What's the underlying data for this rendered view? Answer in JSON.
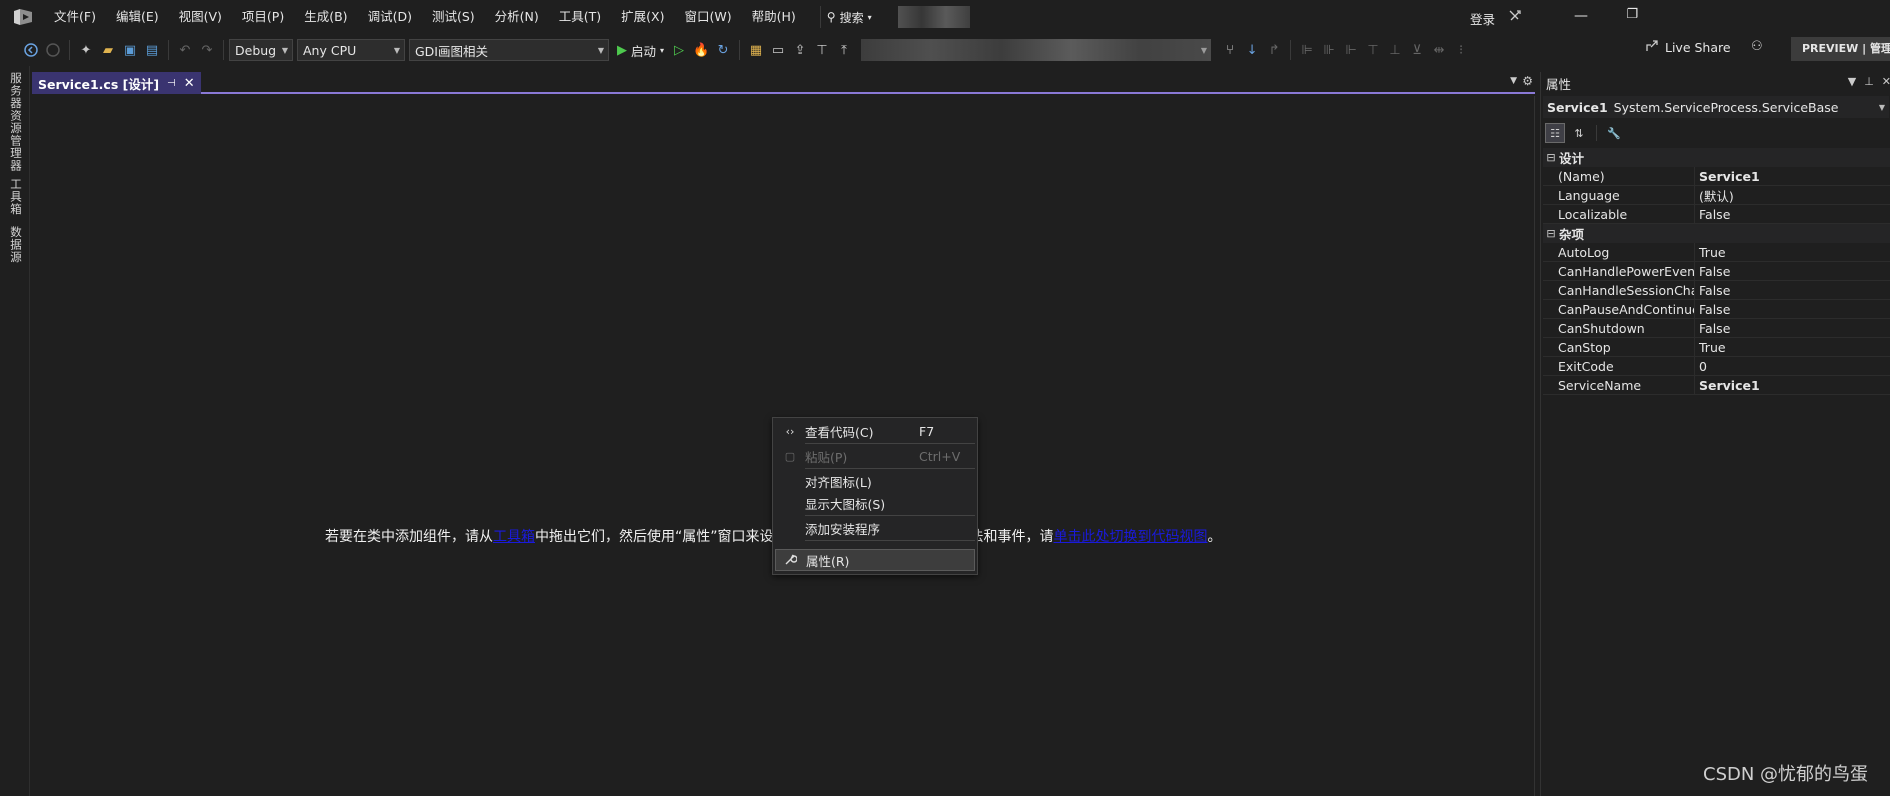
{
  "menubar": {
    "items": [
      "文件(F)",
      "编辑(E)",
      "视图(V)",
      "项目(P)",
      "生成(B)",
      "调试(D)",
      "测试(S)",
      "分析(N)",
      "工具(T)",
      "扩展(X)",
      "窗口(W)",
      "帮助(H)"
    ],
    "search_label": "搜索",
    "login_label": "登录"
  },
  "toolbar": {
    "config": "Debug",
    "platform": "Any CPU",
    "project": "GDI画图相关",
    "start_label": "启动",
    "liveshare_label": "Live Share",
    "preview_label": "PREVIEW | 管理员"
  },
  "left_strip": {
    "tabs": [
      "服务器资源管理器",
      "工具箱",
      "数据源"
    ]
  },
  "document_tab": {
    "title": "Service1.cs [设计]"
  },
  "designer": {
    "hint_prefix": "若要在类中添加组件，请从",
    "hint_link1": "工具箱",
    "hint_middle": "中拖出它们，然后使用“属性”窗口来设置它们的属性。若要为类创建方法和事件，请",
    "hint_link2": "单击此处切换到代码视图",
    "hint_suffix": "。"
  },
  "context_menu": {
    "items": [
      {
        "label": "查看代码(C)",
        "shortcut": "F7",
        "icon": "code-icon",
        "enabled": true
      },
      {
        "label": "粘贴(P)",
        "shortcut": "Ctrl+V",
        "icon": "paste-icon",
        "enabled": false
      },
      {
        "label": "对齐图标(L)",
        "shortcut": "",
        "icon": "",
        "enabled": true
      },
      {
        "label": "显示大图标(S)",
        "shortcut": "",
        "icon": "",
        "enabled": true
      },
      {
        "label": "添加安装程序",
        "shortcut": "",
        "icon": "",
        "enabled": true
      },
      {
        "label": "属性(R)",
        "shortcut": "",
        "icon": "wrench-icon",
        "enabled": true,
        "highlighted": true
      }
    ]
  },
  "properties": {
    "title": "属性",
    "object_name": "Service1",
    "object_type": "System.ServiceProcess.ServiceBase",
    "categories": [
      {
        "name": "设计",
        "rows": [
          {
            "name": "(Name)",
            "value": "Service1",
            "bold": true
          },
          {
            "name": "Language",
            "value": "(默认)",
            "bold": false
          },
          {
            "name": "Localizable",
            "value": "False",
            "bold": false
          }
        ]
      },
      {
        "name": "杂项",
        "rows": [
          {
            "name": "AutoLog",
            "value": "True",
            "bold": false
          },
          {
            "name": "CanHandlePowerEvent",
            "value": "False",
            "bold": false
          },
          {
            "name": "CanHandleSessionChangeEvent",
            "value": "False",
            "bold": false
          },
          {
            "name": "CanPauseAndContinue",
            "value": "False",
            "bold": false
          },
          {
            "name": "CanShutdown",
            "value": "False",
            "bold": false
          },
          {
            "name": "CanStop",
            "value": "True",
            "bold": false
          },
          {
            "name": "ExitCode",
            "value": "0",
            "bold": false
          },
          {
            "name": "ServiceName",
            "value": "Service1",
            "bold": true
          }
        ]
      }
    ]
  },
  "watermark": "CSDN @忧郁的鸟蛋",
  "colors": {
    "accent": "#8a79d6",
    "tab_active": "#3a3470",
    "link": "#1a1adb",
    "background": "#1f1f1f"
  }
}
